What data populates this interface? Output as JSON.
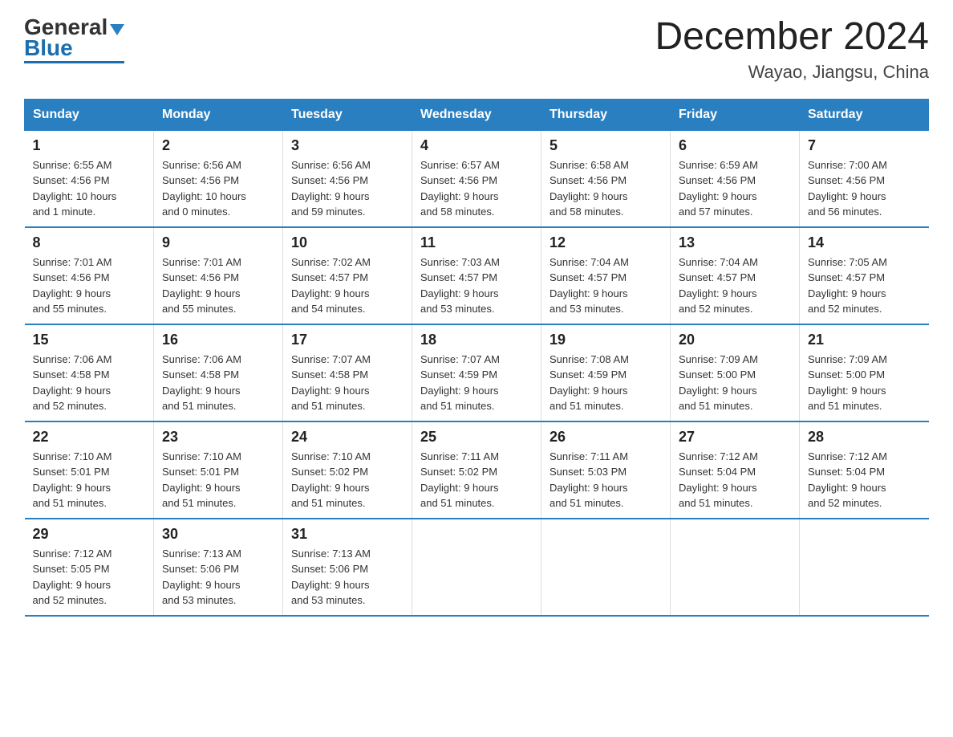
{
  "header": {
    "logo_general": "General",
    "logo_blue": "Blue",
    "title": "December 2024",
    "location": "Wayao, Jiangsu, China"
  },
  "days_of_week": [
    "Sunday",
    "Monday",
    "Tuesday",
    "Wednesday",
    "Thursday",
    "Friday",
    "Saturday"
  ],
  "weeks": [
    [
      {
        "day": "1",
        "sunrise": "6:55 AM",
        "sunset": "4:56 PM",
        "daylight": "10 hours and 1 minute."
      },
      {
        "day": "2",
        "sunrise": "6:56 AM",
        "sunset": "4:56 PM",
        "daylight": "10 hours and 0 minutes."
      },
      {
        "day": "3",
        "sunrise": "6:56 AM",
        "sunset": "4:56 PM",
        "daylight": "9 hours and 59 minutes."
      },
      {
        "day": "4",
        "sunrise": "6:57 AM",
        "sunset": "4:56 PM",
        "daylight": "9 hours and 58 minutes."
      },
      {
        "day": "5",
        "sunrise": "6:58 AM",
        "sunset": "4:56 PM",
        "daylight": "9 hours and 58 minutes."
      },
      {
        "day": "6",
        "sunrise": "6:59 AM",
        "sunset": "4:56 PM",
        "daylight": "9 hours and 57 minutes."
      },
      {
        "day": "7",
        "sunrise": "7:00 AM",
        "sunset": "4:56 PM",
        "daylight": "9 hours and 56 minutes."
      }
    ],
    [
      {
        "day": "8",
        "sunrise": "7:01 AM",
        "sunset": "4:56 PM",
        "daylight": "9 hours and 55 minutes."
      },
      {
        "day": "9",
        "sunrise": "7:01 AM",
        "sunset": "4:56 PM",
        "daylight": "9 hours and 55 minutes."
      },
      {
        "day": "10",
        "sunrise": "7:02 AM",
        "sunset": "4:57 PM",
        "daylight": "9 hours and 54 minutes."
      },
      {
        "day": "11",
        "sunrise": "7:03 AM",
        "sunset": "4:57 PM",
        "daylight": "9 hours and 53 minutes."
      },
      {
        "day": "12",
        "sunrise": "7:04 AM",
        "sunset": "4:57 PM",
        "daylight": "9 hours and 53 minutes."
      },
      {
        "day": "13",
        "sunrise": "7:04 AM",
        "sunset": "4:57 PM",
        "daylight": "9 hours and 52 minutes."
      },
      {
        "day": "14",
        "sunrise": "7:05 AM",
        "sunset": "4:57 PM",
        "daylight": "9 hours and 52 minutes."
      }
    ],
    [
      {
        "day": "15",
        "sunrise": "7:06 AM",
        "sunset": "4:58 PM",
        "daylight": "9 hours and 52 minutes."
      },
      {
        "day": "16",
        "sunrise": "7:06 AM",
        "sunset": "4:58 PM",
        "daylight": "9 hours and 51 minutes."
      },
      {
        "day": "17",
        "sunrise": "7:07 AM",
        "sunset": "4:58 PM",
        "daylight": "9 hours and 51 minutes."
      },
      {
        "day": "18",
        "sunrise": "7:07 AM",
        "sunset": "4:59 PM",
        "daylight": "9 hours and 51 minutes."
      },
      {
        "day": "19",
        "sunrise": "7:08 AM",
        "sunset": "4:59 PM",
        "daylight": "9 hours and 51 minutes."
      },
      {
        "day": "20",
        "sunrise": "7:09 AM",
        "sunset": "5:00 PM",
        "daylight": "9 hours and 51 minutes."
      },
      {
        "day": "21",
        "sunrise": "7:09 AM",
        "sunset": "5:00 PM",
        "daylight": "9 hours and 51 minutes."
      }
    ],
    [
      {
        "day": "22",
        "sunrise": "7:10 AM",
        "sunset": "5:01 PM",
        "daylight": "9 hours and 51 minutes."
      },
      {
        "day": "23",
        "sunrise": "7:10 AM",
        "sunset": "5:01 PM",
        "daylight": "9 hours and 51 minutes."
      },
      {
        "day": "24",
        "sunrise": "7:10 AM",
        "sunset": "5:02 PM",
        "daylight": "9 hours and 51 minutes."
      },
      {
        "day": "25",
        "sunrise": "7:11 AM",
        "sunset": "5:02 PM",
        "daylight": "9 hours and 51 minutes."
      },
      {
        "day": "26",
        "sunrise": "7:11 AM",
        "sunset": "5:03 PM",
        "daylight": "9 hours and 51 minutes."
      },
      {
        "day": "27",
        "sunrise": "7:12 AM",
        "sunset": "5:04 PM",
        "daylight": "9 hours and 51 minutes."
      },
      {
        "day": "28",
        "sunrise": "7:12 AM",
        "sunset": "5:04 PM",
        "daylight": "9 hours and 52 minutes."
      }
    ],
    [
      {
        "day": "29",
        "sunrise": "7:12 AM",
        "sunset": "5:05 PM",
        "daylight": "9 hours and 52 minutes."
      },
      {
        "day": "30",
        "sunrise": "7:13 AM",
        "sunset": "5:06 PM",
        "daylight": "9 hours and 53 minutes."
      },
      {
        "day": "31",
        "sunrise": "7:13 AM",
        "sunset": "5:06 PM",
        "daylight": "9 hours and 53 minutes."
      },
      null,
      null,
      null,
      null
    ]
  ],
  "labels": {
    "sunrise": "Sunrise:",
    "sunset": "Sunset:",
    "daylight": "Daylight:"
  }
}
